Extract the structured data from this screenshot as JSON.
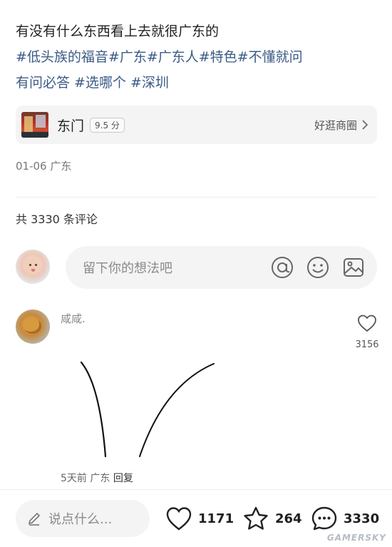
{
  "post": {
    "text": "有没有什么东西看上去就很广东的",
    "tags_line1": "#低头族的福音#广东#广东人#特色#不懂就问",
    "tags_line2": "有问必答 #选哪个 #深圳"
  },
  "poi": {
    "name": "东门",
    "score": "9.5 分",
    "link_label": "好逛商圈"
  },
  "post_meta": "01-06 广东",
  "comments_count": "共 3330 条评论",
  "comment_input": {
    "placeholder": "留下你的想法吧",
    "icons": [
      "at-icon",
      "emoji-icon",
      "image-icon"
    ]
  },
  "comment": {
    "author": "咸咸.",
    "likes": "3156",
    "time": "5天前",
    "location": "广东",
    "reply_label": "回复"
  },
  "bottom_bar": {
    "say_placeholder": "说点什么...",
    "likes": "1171",
    "stars": "264",
    "comments": "3330"
  },
  "watermark": "GAMERSKY"
}
